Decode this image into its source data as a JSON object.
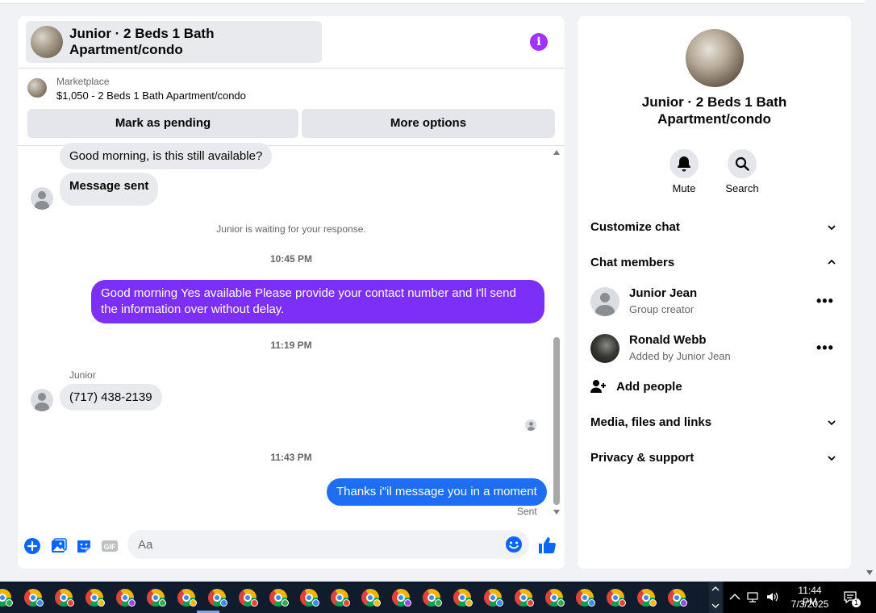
{
  "chat": {
    "title": "Junior · 2 Beds 1 Bath Apartment/condo",
    "info_icon": "i",
    "marketplace_label": "Marketplace",
    "listing_text": "$1,050 - 2 Beds 1 Bath Apartment/condo",
    "mark_pending_label": "Mark as pending",
    "more_options_label": "More options"
  },
  "messages": {
    "msg1": "Good morning, is this still available?",
    "msg2": "Message sent",
    "waiting_notice": "Junior is waiting for your response.",
    "ts1": "10:45 PM",
    "reply1": "Good morning Yes available Please provide your contact number and I'll send the information over without delay.",
    "ts2": "11:19 PM",
    "sender_name": "Junior",
    "msg3": "(717) 438-2139",
    "ts3": "11:43 PM",
    "reply2": "Thanks i\"il message you in a moment",
    "sent_status": "Sent",
    "outgoing_color": "#7b2ff7",
    "outgoing_color_2": "#1d6ef2"
  },
  "composer": {
    "placeholder": "Aa",
    "icons": [
      "plus-circle-icon",
      "photo-icon",
      "sticker-icon",
      "gif-icon",
      "emoji-icon",
      "thumbs-up-icon"
    ]
  },
  "side": {
    "title": "Junior · 2 Beds 1 Bath Apartment/condo",
    "mute_label": "Mute",
    "search_label": "Search",
    "customize_label": "Customize chat",
    "members_label": "Chat members",
    "members": [
      {
        "name": "Junior Jean",
        "role": "Group creator"
      },
      {
        "name": "Ronald Webb",
        "role": "Added by Junior Jean"
      }
    ],
    "add_people_label": "Add people",
    "media_label": "Media, files and links",
    "privacy_label": "Privacy & support"
  },
  "taskbar": {
    "time": "11:44 PM",
    "date": "7/3/2025",
    "notification_count": "1"
  }
}
